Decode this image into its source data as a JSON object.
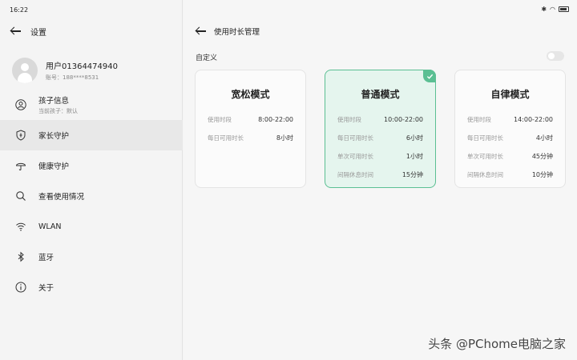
{
  "status": {
    "time": "16:22"
  },
  "left": {
    "title": "设置",
    "user": {
      "name": "用户01364474940",
      "account": "账号：188****8531"
    },
    "nav": [
      {
        "label": "孩子信息",
        "sub": "当前孩子：默认",
        "icon": "person-icon"
      },
      {
        "label": "家长守护",
        "sub": "",
        "icon": "shield-icon"
      },
      {
        "label": "健康守护",
        "sub": "",
        "icon": "umbrella-icon"
      },
      {
        "label": "查看使用情况",
        "sub": "",
        "icon": "search-icon"
      },
      {
        "label": "WLAN",
        "sub": "",
        "icon": "wifi-icon"
      },
      {
        "label": "蓝牙",
        "sub": "",
        "icon": "bluetooth-icon"
      },
      {
        "label": "关于",
        "sub": "",
        "icon": "info-icon"
      }
    ]
  },
  "right": {
    "title": "使用时长管理",
    "custom_label": "自定义",
    "modes": [
      {
        "title": "宽松模式",
        "rows": [
          {
            "key": "使用时段",
            "value": "8:00-22:00"
          },
          {
            "key": "每日可用时长",
            "value": "8小时"
          }
        ]
      },
      {
        "title": "普通模式",
        "rows": [
          {
            "key": "使用时段",
            "value": "10:00-22:00"
          },
          {
            "key": "每日可用时长",
            "value": "6小时"
          },
          {
            "key": "单次可用时长",
            "value": "1小时"
          },
          {
            "key": "间隔休息时间",
            "value": "15分钟"
          }
        ]
      },
      {
        "title": "自律模式",
        "rows": [
          {
            "key": "使用时段",
            "value": "14:00-22:00"
          },
          {
            "key": "每日可用时长",
            "value": "4小时"
          },
          {
            "key": "单次可用时长",
            "value": "45分钟"
          },
          {
            "key": "间隔休息时间",
            "value": "10分钟"
          }
        ]
      }
    ]
  },
  "watermark": "头条 @PChome电脑之家",
  "colors": {
    "accent": "#5bbf93",
    "selected_bg": "#e5f5ee"
  }
}
